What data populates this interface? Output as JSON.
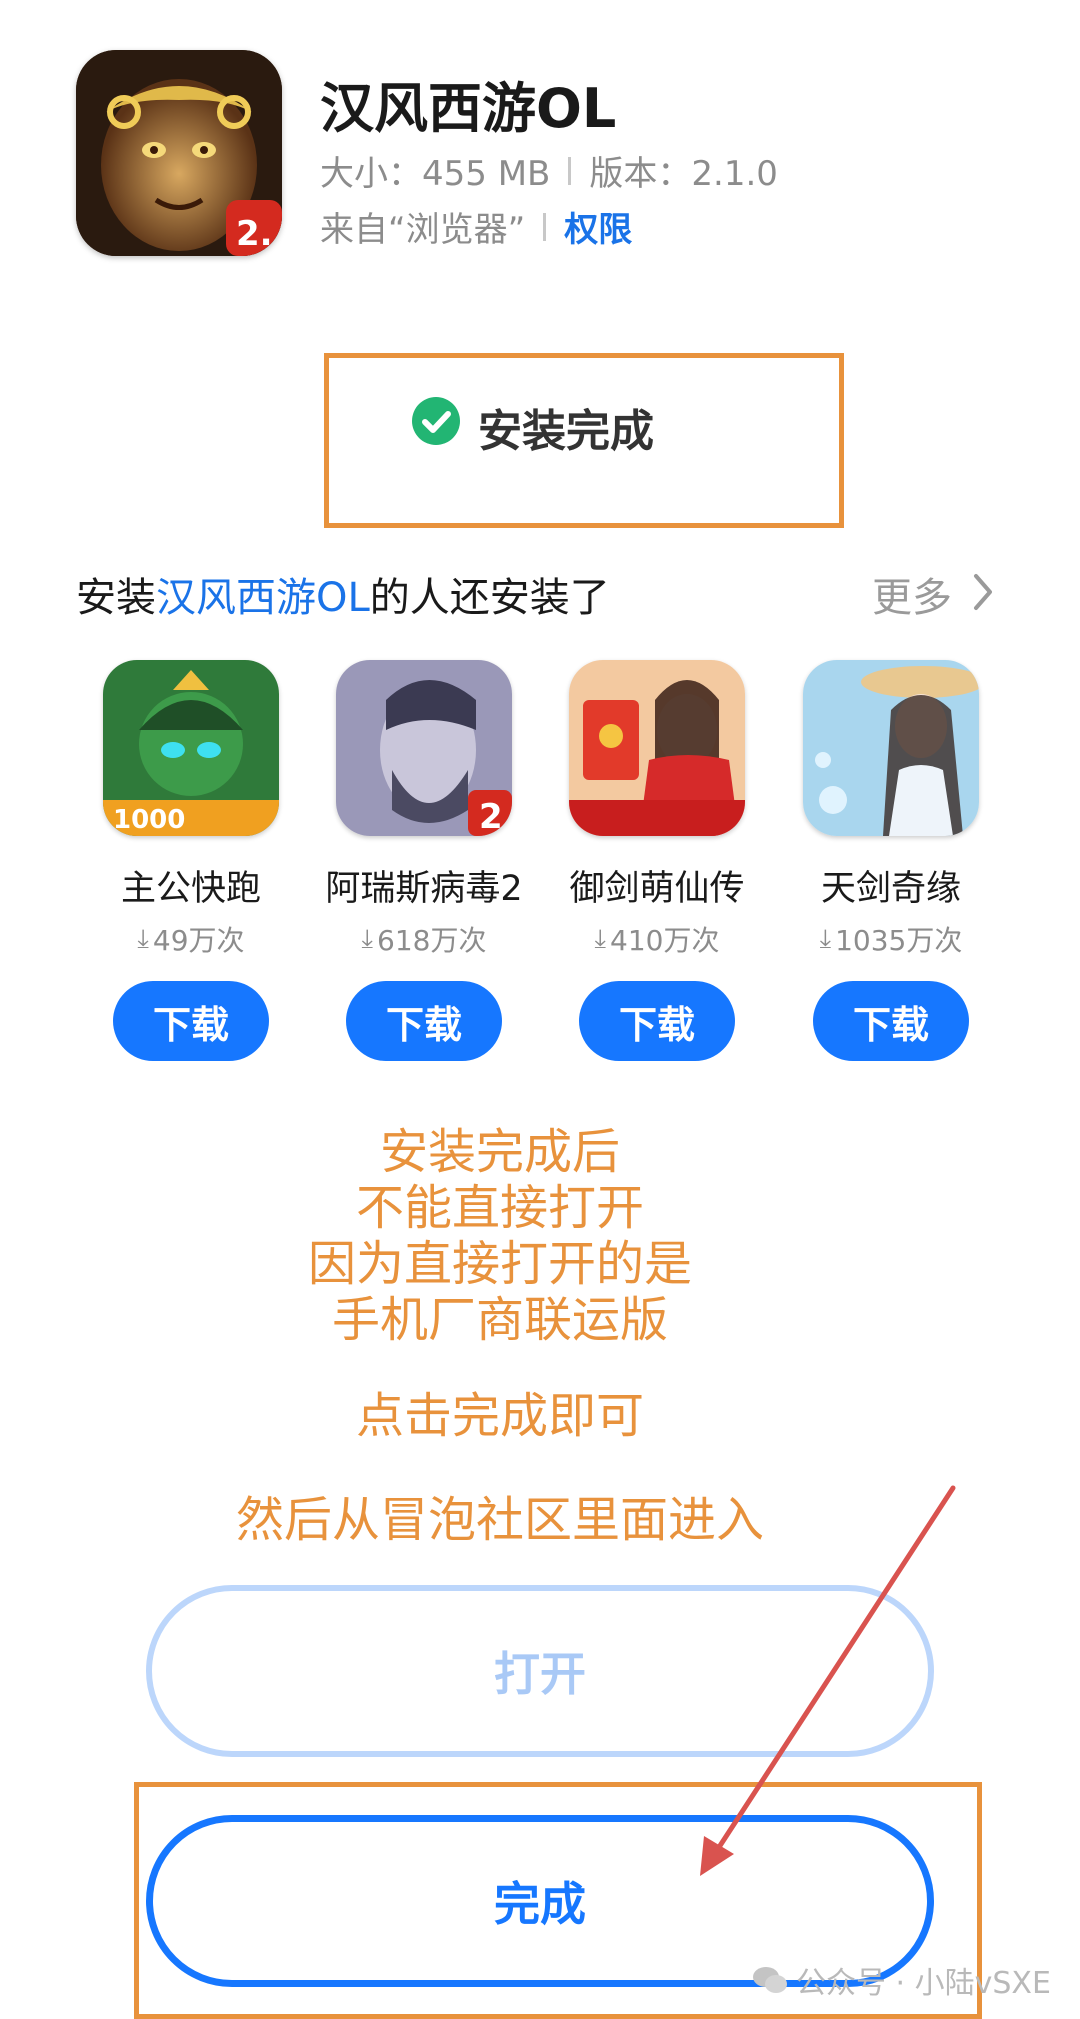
{
  "app": {
    "title": "汉风西游OL",
    "size": "大小：455 MB",
    "version": "版本：2.1.0",
    "source": "来自“浏览器”",
    "permissions": "权限",
    "icon": "monkey-king-game-icon"
  },
  "status": {
    "text": "安装完成",
    "icon": "check-circle-icon"
  },
  "recommend": {
    "prefix": "安装",
    "app_name": "汉风西游OL",
    "suffix": "的人还安装了",
    "more": "更多",
    "items": [
      {
        "name": "主公快跑",
        "count": "49万次",
        "button": "下载",
        "icon": "warrior-game-icon"
      },
      {
        "name": "阿瑞斯病毒2",
        "count": "618万次",
        "button": "下载",
        "icon": "bearded-man-game-icon"
      },
      {
        "name": "御剑萌仙传",
        "count": "410万次",
        "button": "下载",
        "icon": "red-envelope-game-icon"
      },
      {
        "name": "天剑奇缘",
        "count": "1035万次",
        "button": "下载",
        "icon": "fairy-game-icon"
      }
    ]
  },
  "instructions": {
    "line1": "安装完成后",
    "line2": "不能直接打开",
    "line3": "因为直接打开的是",
    "line4": "手机厂商联运版",
    "line5": "点击完成即可",
    "line6": "然后从冒泡社区里面进入"
  },
  "buttons": {
    "open": "打开",
    "done": "完成"
  },
  "watermark": "公众号 · 小陆vSXE",
  "colors": {
    "accent": "#1677ff",
    "annotation": "#e8923c",
    "success": "#22b573",
    "arrow": "#d9534f"
  }
}
